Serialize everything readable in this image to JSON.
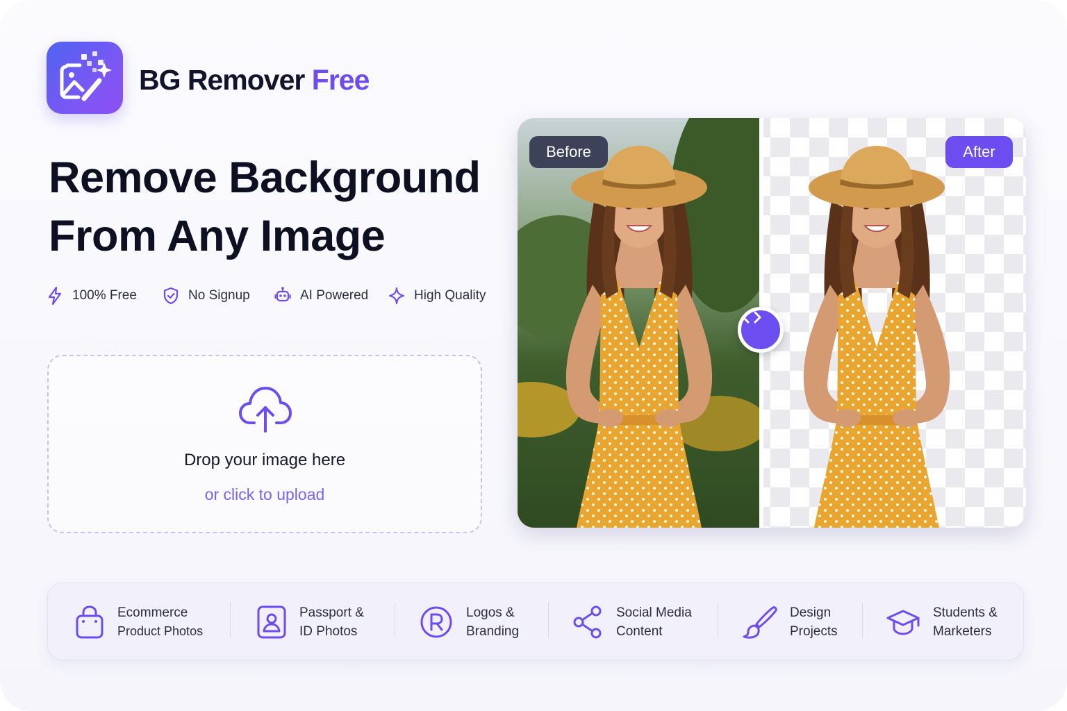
{
  "brand": {
    "name_part1": "BG Remover",
    "name_part2": "Free",
    "logo_icon": "magic-image-icon"
  },
  "hero": {
    "line1": "Remove Background",
    "line2": "From Any Image"
  },
  "features": [
    {
      "label": "100% Free",
      "icon": "lightning-icon"
    },
    {
      "label": "No Signup",
      "icon": "shield-check-icon"
    },
    {
      "label": "AI Powered",
      "icon": "robot-icon"
    },
    {
      "label": "High Quality",
      "icon": "sparkle-icon"
    }
  ],
  "upload": {
    "title": "Drop your image here",
    "subtitle": "or click to upload",
    "icon": "cloud-upload-icon"
  },
  "compare": {
    "before_label": "Before",
    "after_label": "After",
    "handle_icon": "code-arrows-icon"
  },
  "use_cases": [
    {
      "line1": "Ecommerce",
      "line2": "Product Photos",
      "icon": "shopping-bag-icon"
    },
    {
      "line1": "Passport &",
      "line2": "ID Photos",
      "icon": "id-card-icon"
    },
    {
      "line1": "Logos &",
      "line2": "Branding",
      "icon": "registered-icon"
    },
    {
      "line1": "Social Media",
      "line2": "Content",
      "icon": "share-icon"
    },
    {
      "line1": "Design",
      "line2": "Projects",
      "icon": "brush-icon"
    },
    {
      "line1": "Students &",
      "line2": "Marketers",
      "icon": "graduation-cap-icon"
    }
  ],
  "colors": {
    "accent": "#6b4df0",
    "dark": "#0d1020",
    "before_tag": "#3e4259"
  }
}
